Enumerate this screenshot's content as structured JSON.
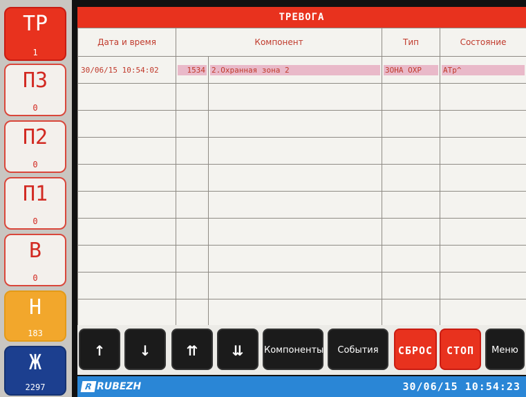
{
  "sidebar": {
    "items": [
      {
        "code": "ТР",
        "count": "1"
      },
      {
        "code": "ПЗ",
        "count": "0"
      },
      {
        "code": "П2",
        "count": "0"
      },
      {
        "code": "П1",
        "count": "0"
      },
      {
        "code": "В",
        "count": "0"
      },
      {
        "code": "Н",
        "count": "183"
      },
      {
        "code": "Ж",
        "count": "2297"
      }
    ]
  },
  "header": {
    "title": "ТРЕВОГА"
  },
  "table": {
    "columns": [
      "Дата и время",
      "Компонент",
      "Тип",
      "Состояние"
    ],
    "rows": [
      {
        "datetime": "30/06/15 10:54:02",
        "number": "1534",
        "component": "2.Охранная зона 2",
        "type": "ЗОНА ОХР",
        "state": "АТр^"
      }
    ]
  },
  "buttons": {
    "up": "↑",
    "down": "↓",
    "page_up": "⇈",
    "page_down": "⇊",
    "components": "Компоненты",
    "events": "События",
    "reset": "СБРОС",
    "stop": "СТОП",
    "menu": "Меню"
  },
  "status": {
    "logo": "RUBEZH",
    "datetime": "30/06/15 10:54:23"
  },
  "colors": {
    "accent_red": "#e8321e",
    "status_blue": "#2a86d6",
    "orange": "#f2a72c",
    "navy": "#1c3f8f"
  }
}
